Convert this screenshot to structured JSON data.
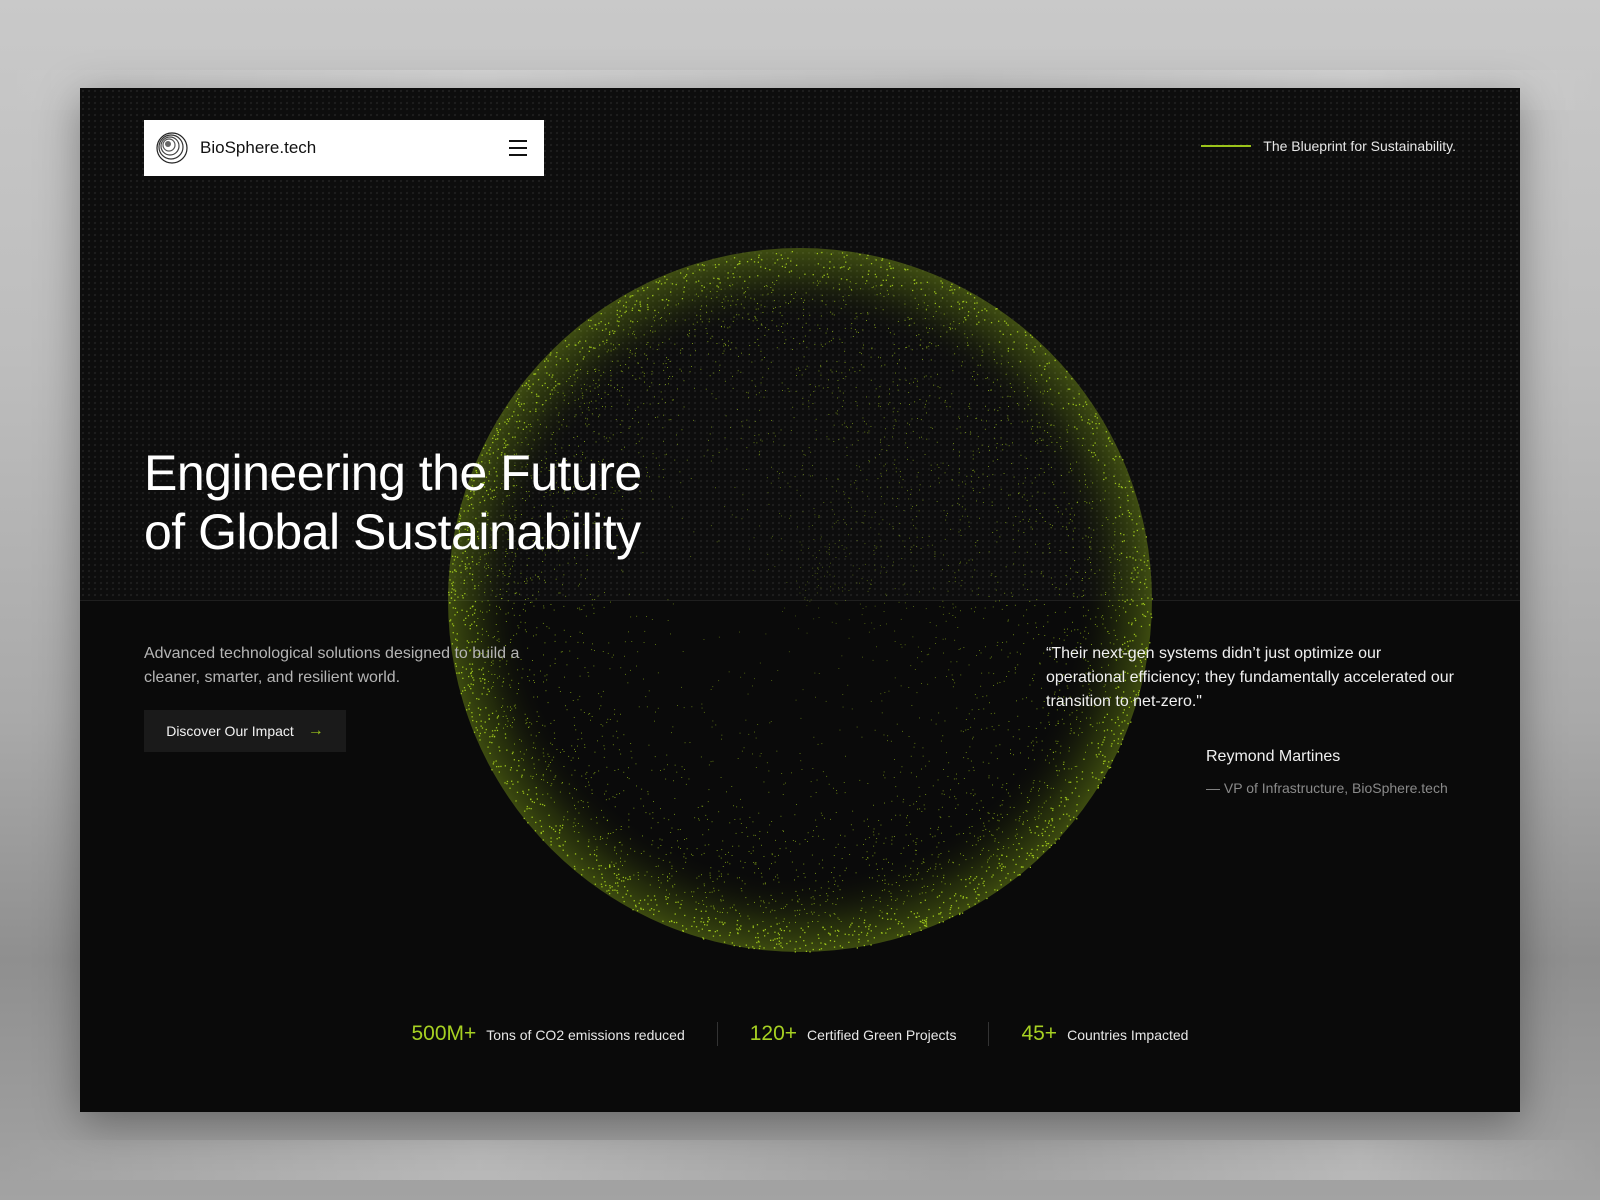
{
  "brand": {
    "name": "BioSphere.tech"
  },
  "tagline": "The Blueprint for Sustainability.",
  "hero": {
    "headline_line1": "Engineering the Future",
    "headline_line2": "of Global Sustainability",
    "subtext": "Advanced technological solutions designed to build a cleaner, smarter, and resilient world.",
    "cta_label": "Discover Our Impact"
  },
  "testimonial": {
    "quote": "“Their next-gen systems didn’t just optimize our operational efficiency; they fundamentally accelerated our transition to net-zero.\"",
    "author": "Reymond Martines",
    "role": "— VP of Infrastructure, BioSphere.tech"
  },
  "stats": [
    {
      "value": "500M+",
      "label": "Tons of CO2 emissions reduced"
    },
    {
      "value": "120+",
      "label": "Certified Green Projects"
    },
    {
      "value": "45+",
      "label": "Countries Impacted"
    }
  ],
  "colors": {
    "accent": "#9bc31a",
    "background": "#0a0a0a",
    "text": "#ffffff"
  },
  "icons": {
    "menu": "hamburger-icon",
    "arrow": "arrow-right-icon",
    "logo": "concentric-circles-icon"
  }
}
